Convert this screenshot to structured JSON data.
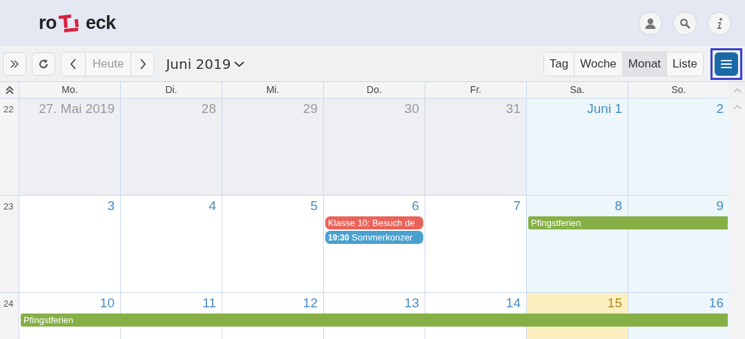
{
  "logo": {
    "left": "ro",
    "right": "eck"
  },
  "header_buttons": [
    {
      "kind": "user"
    },
    {
      "kind": "search"
    },
    {
      "kind": "info"
    }
  ],
  "toolbar": {
    "nav_buttons": [
      {
        "kind": "prev"
      },
      {
        "kind": "today",
        "label": "Heute",
        "disabled": true
      },
      {
        "kind": "next"
      }
    ],
    "title": "Juni 2019",
    "views": [
      {
        "label": "Tag",
        "selected": false
      },
      {
        "label": "Woche",
        "selected": false
      },
      {
        "label": "Monat",
        "selected": true
      },
      {
        "label": "Liste",
        "selected": false
      }
    ],
    "menu_button": {
      "highlighted": true
    }
  },
  "weekdays": [
    "Mo.",
    "Di.",
    "Mi.",
    "Do.",
    "Fr.",
    "Sa.",
    "So."
  ],
  "weeks": [
    {
      "number": "22",
      "days": [
        {
          "label": "27. Mai 2019",
          "kind": "other"
        },
        {
          "label": "28",
          "kind": "other"
        },
        {
          "label": "29",
          "kind": "other"
        },
        {
          "label": "30",
          "kind": "other"
        },
        {
          "label": "31",
          "kind": "other"
        },
        {
          "label": "Juni 1",
          "kind": "weekend"
        },
        {
          "label": "2",
          "kind": "weekend"
        }
      ]
    },
    {
      "number": "23",
      "days": [
        {
          "label": "3",
          "kind": "normal"
        },
        {
          "label": "4",
          "kind": "normal"
        },
        {
          "label": "5",
          "kind": "normal"
        },
        {
          "label": "6",
          "kind": "normal",
          "events": [
            {
              "title": "Klasse 10: Besuch de",
              "color": "#e8645a",
              "to_week_end": false
            },
            {
              "time": "19:30",
              "title": "Sommerkonzer",
              "color": "#4aa0cf",
              "to_week_end": false
            }
          ]
        },
        {
          "label": "7",
          "kind": "normal"
        },
        {
          "label": "8",
          "kind": "weekend",
          "events": [
            {
              "title": "Pfingstferien",
              "color": "#86b046",
              "to_week_end": true
            }
          ]
        },
        {
          "label": "9",
          "kind": "weekend"
        }
      ]
    },
    {
      "number": "24",
      "days": [
        {
          "label": "10",
          "kind": "normal",
          "events": [
            {
              "title": "Pfingstferien",
              "color": "#86b046",
              "to_week_end": true
            }
          ]
        },
        {
          "label": "11",
          "kind": "normal"
        },
        {
          "label": "12",
          "kind": "normal"
        },
        {
          "label": "13",
          "kind": "normal"
        },
        {
          "label": "14",
          "kind": "normal"
        },
        {
          "label": "15",
          "kind": "today"
        },
        {
          "label": "16",
          "kind": "weekend"
        }
      ]
    }
  ]
}
